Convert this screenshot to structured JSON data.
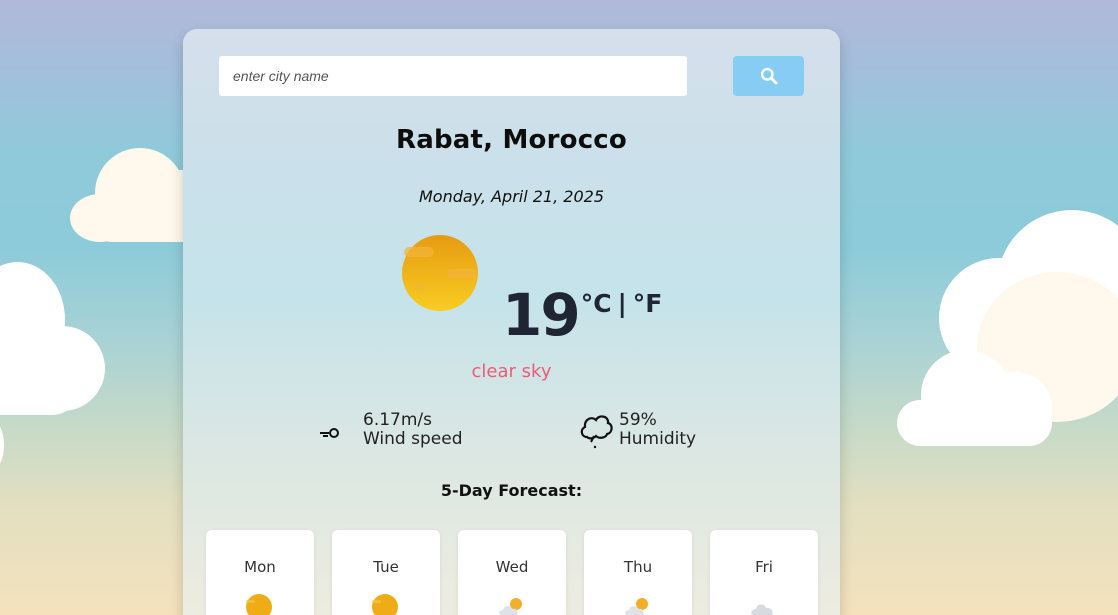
{
  "search": {
    "placeholder": "enter city name",
    "button_icon": "search-icon"
  },
  "location": {
    "city_country": "Rabat, Morocco",
    "date": "Monday, April 21, 2025"
  },
  "current": {
    "icon": "sun-icon",
    "temperature": "19",
    "unit_celsius": "°C",
    "unit_separator": "|",
    "unit_fahrenheit": "°F",
    "description": "clear sky",
    "wind_value": "6.17m/s",
    "wind_label": "Wind speed",
    "wind_icon": "wind-icon",
    "humidity_value": "59%",
    "humidity_label": "Humidity",
    "humidity_icon": "humidity-cloud-icon"
  },
  "forecast": {
    "title": "5-Day Forecast:",
    "days": [
      {
        "name": "Mon",
        "icon": "sun-icon"
      },
      {
        "name": "Tue",
        "icon": "sun-icon"
      },
      {
        "name": "Wed",
        "icon": "partly-cloudy-icon"
      },
      {
        "name": "Thu",
        "icon": "partly-cloudy-rain-icon"
      },
      {
        "name": "Fri",
        "icon": "cloud-icon"
      }
    ]
  },
  "colors": {
    "accent_button": "#87cdf3",
    "description_text": "#ee5b7a",
    "sun": "#f2b41a"
  }
}
